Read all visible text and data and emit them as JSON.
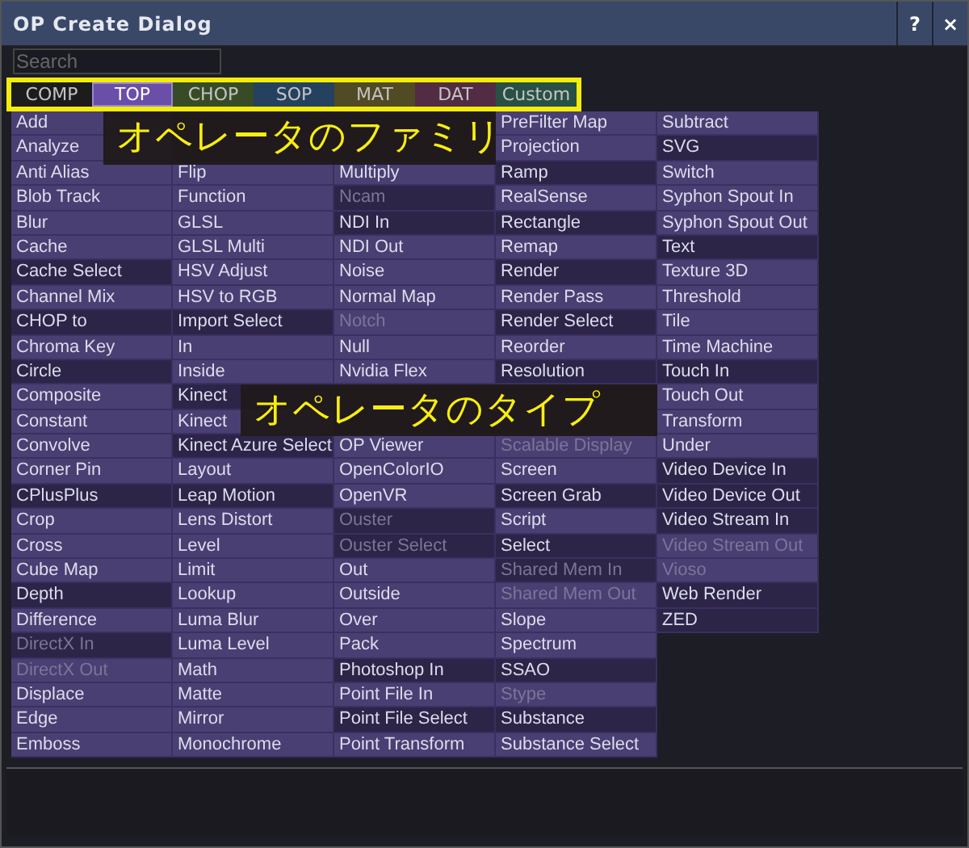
{
  "window": {
    "title": "OP Create Dialog",
    "buttons": [
      "?",
      "×"
    ]
  },
  "search": {
    "placeholder": "Search"
  },
  "tabs": [
    {
      "label": "COMP",
      "color": "#1c1c1c",
      "selected": false
    },
    {
      "label": "TOP",
      "color": "#6a4fa8",
      "selected": true
    },
    {
      "label": "CHOP",
      "color": "#3c5527",
      "selected": false
    },
    {
      "label": "SOP",
      "color": "#26486a",
      "selected": false
    },
    {
      "label": "MAT",
      "color": "#5a5424",
      "selected": false
    },
    {
      "label": "DAT",
      "color": "#5c2f4a",
      "selected": false
    },
    {
      "label": "Custom",
      "color": "#2c5a4a",
      "selected": false
    }
  ],
  "annotations": [
    "オペレータのファミリ",
    "オペレータのタイプ"
  ],
  "columns": [
    [
      {
        "text": "Add",
        "highlighted": false,
        "disabled": false
      },
      {
        "text": "Analyze",
        "highlighted": false,
        "disabled": false
      },
      {
        "text": "Anti Alias",
        "highlighted": false,
        "disabled": false
      },
      {
        "text": "Blob Track",
        "highlighted": false,
        "disabled": false
      },
      {
        "text": "Blur",
        "highlighted": false,
        "disabled": false
      },
      {
        "text": "Cache",
        "highlighted": false,
        "disabled": false
      },
      {
        "text": "Cache Select",
        "highlighted": true,
        "disabled": false
      },
      {
        "text": "Channel Mix",
        "highlighted": false,
        "disabled": false
      },
      {
        "text": "CHOP to",
        "highlighted": true,
        "disabled": false
      },
      {
        "text": "Chroma Key",
        "highlighted": false,
        "disabled": false
      },
      {
        "text": "Circle",
        "highlighted": true,
        "disabled": false
      },
      {
        "text": "Composite",
        "highlighted": false,
        "disabled": false
      },
      {
        "text": "Constant",
        "highlighted": false,
        "disabled": false
      },
      {
        "text": "Convolve",
        "highlighted": false,
        "disabled": false
      },
      {
        "text": "Corner Pin",
        "highlighted": false,
        "disabled": false
      },
      {
        "text": "CPlusPlus",
        "highlighted": true,
        "disabled": false
      },
      {
        "text": "Crop",
        "highlighted": false,
        "disabled": false
      },
      {
        "text": "Cross",
        "highlighted": false,
        "disabled": false
      },
      {
        "text": "Cube Map",
        "highlighted": false,
        "disabled": false
      },
      {
        "text": "Depth",
        "highlighted": true,
        "disabled": false
      },
      {
        "text": "Difference",
        "highlighted": false,
        "disabled": false
      },
      {
        "text": "DirectX In",
        "highlighted": true,
        "disabled": true
      },
      {
        "text": "DirectX Out",
        "highlighted": false,
        "disabled": true
      },
      {
        "text": "Displace",
        "highlighted": false,
        "disabled": false
      },
      {
        "text": "Edge",
        "highlighted": false,
        "disabled": false
      },
      {
        "text": "Emboss",
        "highlighted": false,
        "disabled": false
      }
    ],
    [
      {},
      {},
      {
        "text": "Flip",
        "highlighted": false,
        "disabled": false
      },
      {
        "text": "Function",
        "highlighted": false,
        "disabled": false
      },
      {
        "text": "GLSL",
        "highlighted": false,
        "disabled": false
      },
      {
        "text": "GLSL Multi",
        "highlighted": false,
        "disabled": false
      },
      {
        "text": "HSV Adjust",
        "highlighted": false,
        "disabled": false
      },
      {
        "text": "HSV to RGB",
        "highlighted": false,
        "disabled": false
      },
      {
        "text": "Import Select",
        "highlighted": true,
        "disabled": false
      },
      {
        "text": "In",
        "highlighted": false,
        "disabled": false
      },
      {
        "text": "Inside",
        "highlighted": false,
        "disabled": false
      },
      {
        "text": "Kinect",
        "highlighted": true,
        "disabled": false
      },
      {
        "text": "Kinect",
        "highlighted": false,
        "disabled": false
      },
      {
        "text": "Kinect Azure Select",
        "highlighted": true,
        "disabled": false
      },
      {
        "text": "Layout",
        "highlighted": false,
        "disabled": false
      },
      {
        "text": "Leap Motion",
        "highlighted": true,
        "disabled": false
      },
      {
        "text": "Lens Distort",
        "highlighted": false,
        "disabled": false
      },
      {
        "text": "Level",
        "highlighted": false,
        "disabled": false
      },
      {
        "text": "Limit",
        "highlighted": false,
        "disabled": false
      },
      {
        "text": "Lookup",
        "highlighted": false,
        "disabled": false
      },
      {
        "text": "Luma Blur",
        "highlighted": false,
        "disabled": false
      },
      {
        "text": "Luma Level",
        "highlighted": false,
        "disabled": false
      },
      {
        "text": "Math",
        "highlighted": false,
        "disabled": false
      },
      {
        "text": "Matte",
        "highlighted": false,
        "disabled": false
      },
      {
        "text": "Mirror",
        "highlighted": false,
        "disabled": false
      },
      {
        "text": "Monochrome",
        "highlighted": false,
        "disabled": false
      }
    ],
    [
      {},
      {},
      {
        "text": "Multiply",
        "highlighted": false,
        "disabled": false
      },
      {
        "text": "Ncam",
        "highlighted": true,
        "disabled": true
      },
      {
        "text": "NDI In",
        "highlighted": true,
        "disabled": false
      },
      {
        "text": "NDI Out",
        "highlighted": false,
        "disabled": false
      },
      {
        "text": "Noise",
        "highlighted": false,
        "disabled": false
      },
      {
        "text": "Normal Map",
        "highlighted": false,
        "disabled": false
      },
      {
        "text": "Notch",
        "highlighted": false,
        "disabled": true
      },
      {
        "text": "Null",
        "highlighted": false,
        "disabled": false
      },
      {
        "text": "Nvidia Flex",
        "highlighted": false,
        "disabled": false
      },
      {},
      {},
      {
        "text": "OP Viewer",
        "highlighted": false,
        "disabled": false
      },
      {
        "text": "OpenColorIO",
        "highlighted": false,
        "disabled": false
      },
      {
        "text": "OpenVR",
        "highlighted": false,
        "disabled": false
      },
      {
        "text": "Ouster",
        "highlighted": true,
        "disabled": true
      },
      {
        "text": "Ouster Select",
        "highlighted": true,
        "disabled": true
      },
      {
        "text": "Out",
        "highlighted": false,
        "disabled": false
      },
      {
        "text": "Outside",
        "highlighted": false,
        "disabled": false
      },
      {
        "text": "Over",
        "highlighted": false,
        "disabled": false
      },
      {
        "text": "Pack",
        "highlighted": false,
        "disabled": false
      },
      {
        "text": "Photoshop In",
        "highlighted": true,
        "disabled": false
      },
      {
        "text": "Point File In",
        "highlighted": false,
        "disabled": false
      },
      {
        "text": "Point File Select",
        "highlighted": true,
        "disabled": false
      },
      {
        "text": "Point Transform",
        "highlighted": false,
        "disabled": false
      }
    ],
    [
      {
        "text": "PreFilter Map",
        "highlighted": false,
        "disabled": false
      },
      {
        "text": "Projection",
        "highlighted": false,
        "disabled": false
      },
      {
        "text": "Ramp",
        "highlighted": true,
        "disabled": false
      },
      {
        "text": "RealSense",
        "highlighted": false,
        "disabled": false
      },
      {
        "text": "Rectangle",
        "highlighted": true,
        "disabled": false
      },
      {
        "text": "Remap",
        "highlighted": false,
        "disabled": false
      },
      {
        "text": "Render",
        "highlighted": true,
        "disabled": false
      },
      {
        "text": "Render Pass",
        "highlighted": false,
        "disabled": false
      },
      {
        "text": "Render Select",
        "highlighted": true,
        "disabled": false
      },
      {
        "text": "Reorder",
        "highlighted": false,
        "disabled": false
      },
      {
        "text": "Resolution",
        "highlighted": true,
        "disabled": false
      },
      {},
      {},
      {
        "text": "Scalable Display",
        "highlighted": false,
        "disabled": true
      },
      {
        "text": "Screen",
        "highlighted": false,
        "disabled": false
      },
      {
        "text": "Screen Grab",
        "highlighted": true,
        "disabled": false
      },
      {
        "text": "Script",
        "highlighted": false,
        "disabled": false
      },
      {
        "text": "Select",
        "highlighted": true,
        "disabled": false
      },
      {
        "text": "Shared Mem In",
        "highlighted": true,
        "disabled": true
      },
      {
        "text": "Shared Mem Out",
        "highlighted": false,
        "disabled": true
      },
      {
        "text": "Slope",
        "highlighted": false,
        "disabled": false
      },
      {
        "text": "Spectrum",
        "highlighted": false,
        "disabled": false
      },
      {
        "text": "SSAO",
        "highlighted": true,
        "disabled": false
      },
      {
        "text": "Stype",
        "highlighted": false,
        "disabled": true
      },
      {
        "text": "Substance",
        "highlighted": true,
        "disabled": false
      },
      {
        "text": "Substance Select",
        "highlighted": false,
        "disabled": false
      }
    ],
    [
      {
        "text": "Subtract",
        "highlighted": false,
        "disabled": false
      },
      {
        "text": "SVG",
        "highlighted": true,
        "disabled": false
      },
      {
        "text": "Switch",
        "highlighted": false,
        "disabled": false
      },
      {
        "text": "Syphon Spout In",
        "highlighted": false,
        "disabled": false
      },
      {
        "text": "Syphon Spout Out",
        "highlighted": false,
        "disabled": false
      },
      {
        "text": "Text",
        "highlighted": true,
        "disabled": false
      },
      {
        "text": "Texture 3D",
        "highlighted": false,
        "disabled": false
      },
      {
        "text": "Threshold",
        "highlighted": false,
        "disabled": false
      },
      {
        "text": "Tile",
        "highlighted": false,
        "disabled": false
      },
      {
        "text": "Time Machine",
        "highlighted": false,
        "disabled": false
      },
      {
        "text": "Touch In",
        "highlighted": true,
        "disabled": false
      },
      {
        "text": "Touch Out",
        "highlighted": false,
        "disabled": false
      },
      {
        "text": "Transform",
        "highlighted": false,
        "disabled": false
      },
      {
        "text": "Under",
        "highlighted": false,
        "disabled": false
      },
      {
        "text": "Video Device In",
        "highlighted": true,
        "disabled": false
      },
      {
        "text": "Video Device Out",
        "highlighted": true,
        "disabled": false
      },
      {
        "text": "Video Stream In",
        "highlighted": true,
        "disabled": false
      },
      {
        "text": "Video Stream Out",
        "highlighted": false,
        "disabled": true
      },
      {
        "text": "Vioso",
        "highlighted": false,
        "disabled": true
      },
      {
        "text": "Web Render",
        "highlighted": true,
        "disabled": false
      },
      {
        "text": "ZED",
        "highlighted": true,
        "disabled": false
      }
    ]
  ]
}
